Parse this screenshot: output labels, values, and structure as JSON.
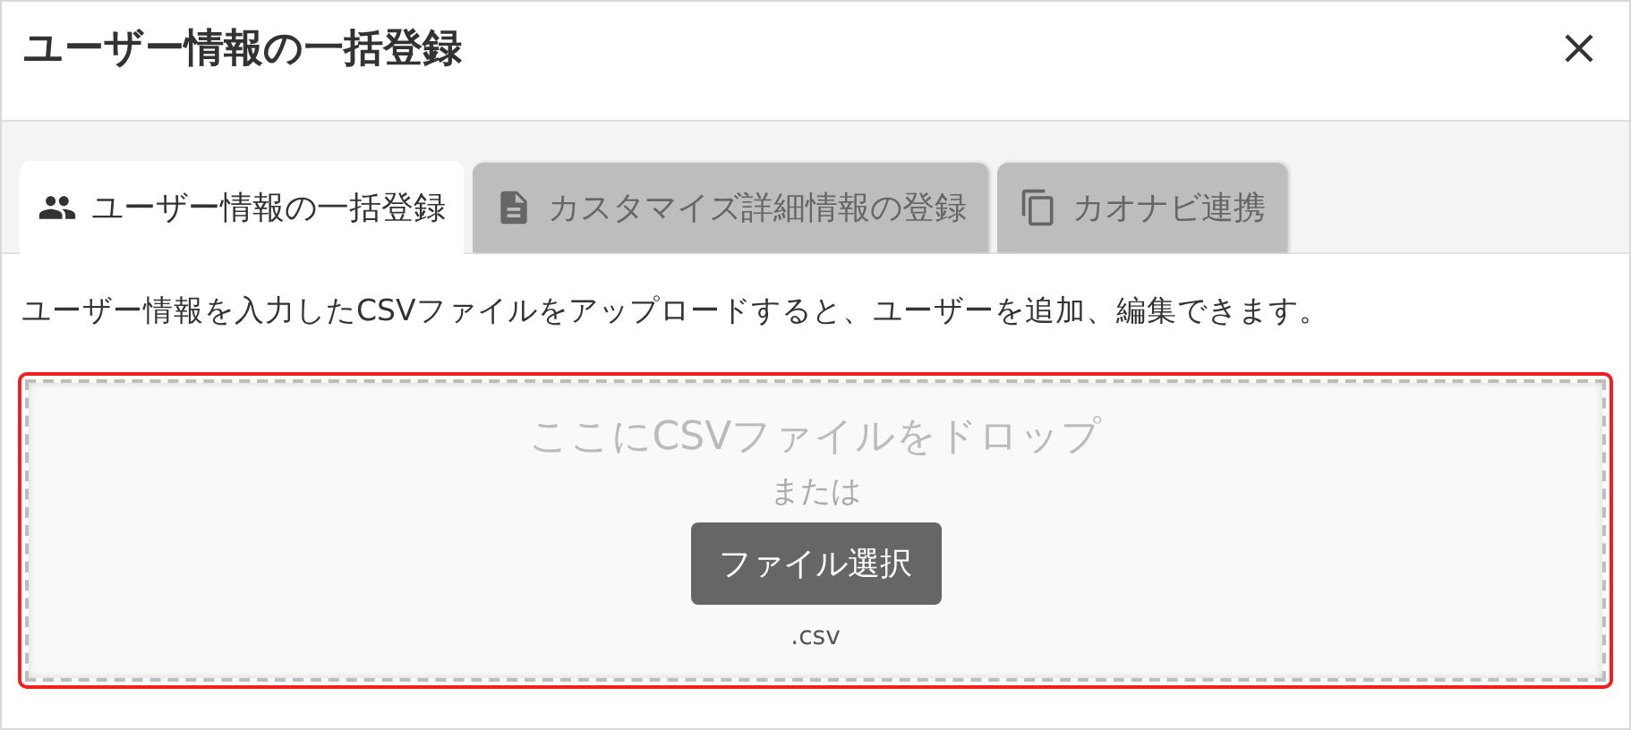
{
  "dialog": {
    "title": "ユーザー情報の一括登録"
  },
  "tabs": [
    {
      "label": "ユーザー情報の一括登録",
      "kind": "people",
      "selected": true
    },
    {
      "label": "カスタマイズ詳細情報の登録",
      "kind": "document",
      "selected": false
    },
    {
      "label": "カオナビ連携",
      "kind": "copy",
      "selected": false
    }
  ],
  "description": "ユーザー情報を入力したCSVファイルをアップロードすると、ユーザーを追加、編集できます。",
  "dropzone": {
    "highlighted": true,
    "prompt": "ここにCSVファイルをドロップ",
    "or": "または",
    "button": "ファイル選択",
    "accepted": ".csv"
  }
}
